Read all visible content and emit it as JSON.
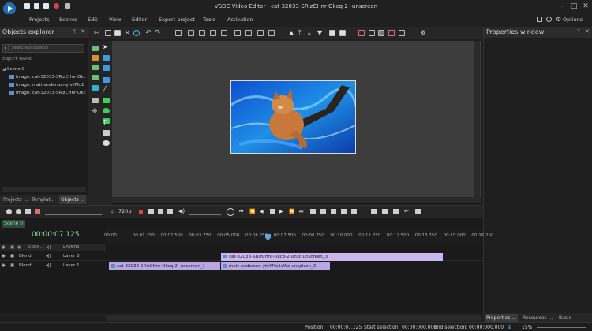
{
  "app": {
    "title": "VSDC Video Editor - cat-32033-SRizCHnr-Okcq-2--unscreen"
  },
  "menu": [
    "Projects",
    "Scenes",
    "Edit",
    "View",
    "Editor",
    "Export project",
    "Tools",
    "Activation"
  ],
  "top_right": {
    "options_label": "Options"
  },
  "objects_explorer": {
    "title": "Objects explorer",
    "search_placeholder": "Searched objects",
    "column_header": "OBJECT NAME",
    "tree": [
      {
        "label": "Scene 0"
      },
      {
        "label": "Image: cat-32033-SRizCHnr-Okc"
      },
      {
        "label": "Image: matt-anderson-yfsYMo1"
      },
      {
        "label": "Image: cat-32033-SRizCHnr-Okc"
      }
    ],
    "tabs": [
      "Projects ...",
      "Templat...",
      "Objects ..."
    ]
  },
  "properties": {
    "title": "Properties window",
    "tabs": [
      "Properties ...",
      "Resources ...",
      "Basic effect..."
    ]
  },
  "playback": {
    "quality": "720p"
  },
  "timeline": {
    "scene_tab": "Scene 0",
    "current_time": "00:00:07.125",
    "ruler_ticks": [
      "00:00",
      "00:01.250",
      "00:02.500",
      "00:03.750",
      "00:05.000",
      "00:06.250",
      "00:07.500",
      "00:08.750",
      "00:10.000",
      "00:11.250",
      "00:12.500",
      "00:13.750",
      "00:15.000",
      "00:16.250"
    ],
    "header": {
      "com": "COM...",
      "layers": "LAYERS"
    },
    "layers": [
      {
        "blend": "Blend",
        "name": "Layer 3",
        "clips": [
          {
            "label": "cat-32033-SRizCHnr-Okcq-2-unsc-unscreen_3",
            "start": 5.0,
            "end": 15.6
          }
        ]
      },
      {
        "blend": "Blend",
        "name": "Layer 1",
        "clips": [
          {
            "label": "cat-32033-SRizCHnr-Okcq-2--unscreen_1",
            "start": 0.0,
            "end": 5.0
          },
          {
            "label": "matt-anderson-ytsYMo1cWo-unsplash_2",
            "start": 5.0,
            "end": 10.0
          }
        ]
      }
    ]
  },
  "status": {
    "position_label": "Position:",
    "position": "00:00:07.125",
    "start_label": "Start selection:",
    "start": "00:00:000.000",
    "end_label": "End selection:",
    "end": "00:00:000.000",
    "zoom": "15%"
  }
}
